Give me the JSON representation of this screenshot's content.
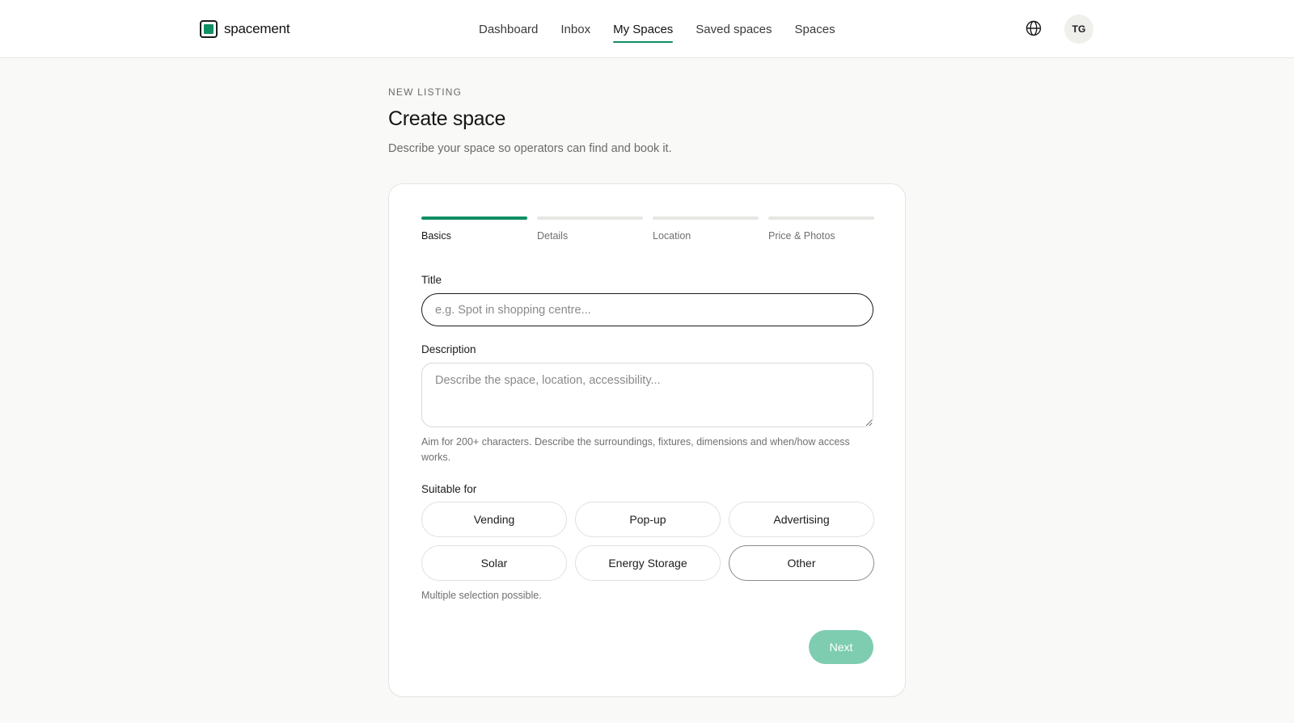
{
  "header": {
    "brand": "spacement",
    "nav": [
      {
        "label": "Dashboard",
        "active": false
      },
      {
        "label": "Inbox",
        "active": false
      },
      {
        "label": "My Spaces",
        "active": true
      },
      {
        "label": "Saved spaces",
        "active": false
      },
      {
        "label": "Spaces",
        "active": false
      }
    ],
    "language_icon": "globe-icon",
    "avatar_initials": "TG"
  },
  "page": {
    "eyebrow": "NEW LISTING",
    "title": "Create space",
    "subtitle": "Describe your space so operators can find and book it."
  },
  "steps": [
    {
      "label": "Basics",
      "active": true
    },
    {
      "label": "Details",
      "active": false
    },
    {
      "label": "Location",
      "active": false
    },
    {
      "label": "Price & Photos",
      "active": false
    }
  ],
  "form": {
    "title_label": "Title",
    "title_value": "",
    "title_placeholder": "e.g. Spot in shopping centre...",
    "description_label": "Description",
    "description_value": "",
    "description_placeholder": "Describe the space, location, accessibility...",
    "description_hint": "Aim for 200+ characters. Describe the surroundings, fixtures, dimensions and when/how access works.",
    "suitable_label": "Suitable for",
    "suitable_options": [
      "Vending",
      "Pop-up",
      "Advertising",
      "Solar",
      "Energy Storage",
      "Other"
    ],
    "suitable_hint": "Multiple selection possible.",
    "next_label": "Next"
  },
  "colors": {
    "accent": "#0f8f62",
    "next_disabled": "#7fcdb0",
    "background": "#f9f9f7"
  }
}
